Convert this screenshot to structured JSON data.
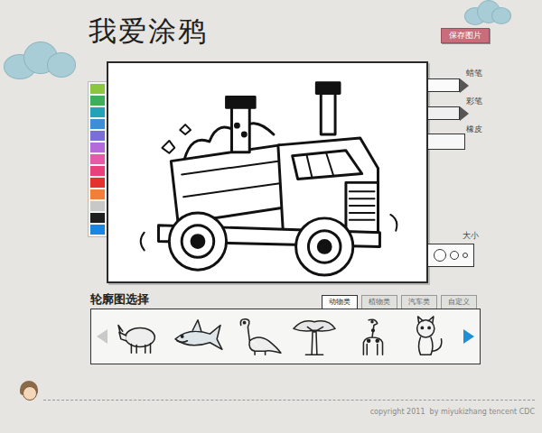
{
  "app": {
    "title": "我爱涂鸦"
  },
  "save_button": {
    "label": "保存图片"
  },
  "palette": [
    {
      "color": "#8cc63f"
    },
    {
      "color": "#3fae5a"
    },
    {
      "color": "#23a3b8"
    },
    {
      "color": "#3b8fd8"
    },
    {
      "color": "#7a6fd6"
    },
    {
      "color": "#b46ad8"
    },
    {
      "color": "#e65aa8"
    },
    {
      "color": "#e8407a"
    },
    {
      "color": "#e53030"
    },
    {
      "color": "#f07f3c"
    },
    {
      "color": "#c8c8c8"
    },
    {
      "color": "#1e1e1e"
    },
    {
      "color": "#1a86e0"
    }
  ],
  "tools": [
    {
      "label": "蜡笔",
      "kind": "crayon"
    },
    {
      "label": "彩笔",
      "kind": "marker"
    },
    {
      "label": "橡皮",
      "kind": "eraser"
    }
  ],
  "size": {
    "label": "大小"
  },
  "outline_picker": {
    "title": "轮廓图选择",
    "tabs": [
      {
        "label": "动物类",
        "selected": true
      },
      {
        "label": "植物类",
        "selected": false
      },
      {
        "label": "汽车类",
        "selected": false
      },
      {
        "label": "自定义",
        "selected": false
      }
    ],
    "prev": {
      "disabled": true
    },
    "next": {
      "disabled": false
    },
    "thumbnails": [
      {
        "kind": "rhino"
      },
      {
        "kind": "shark"
      },
      {
        "kind": "dinosaur"
      },
      {
        "kind": "tree"
      },
      {
        "kind": "giraffe"
      },
      {
        "kind": "cat"
      }
    ]
  },
  "footer": {
    "copyright": "copyright 2011  by miyukizhang tencent CDC"
  }
}
